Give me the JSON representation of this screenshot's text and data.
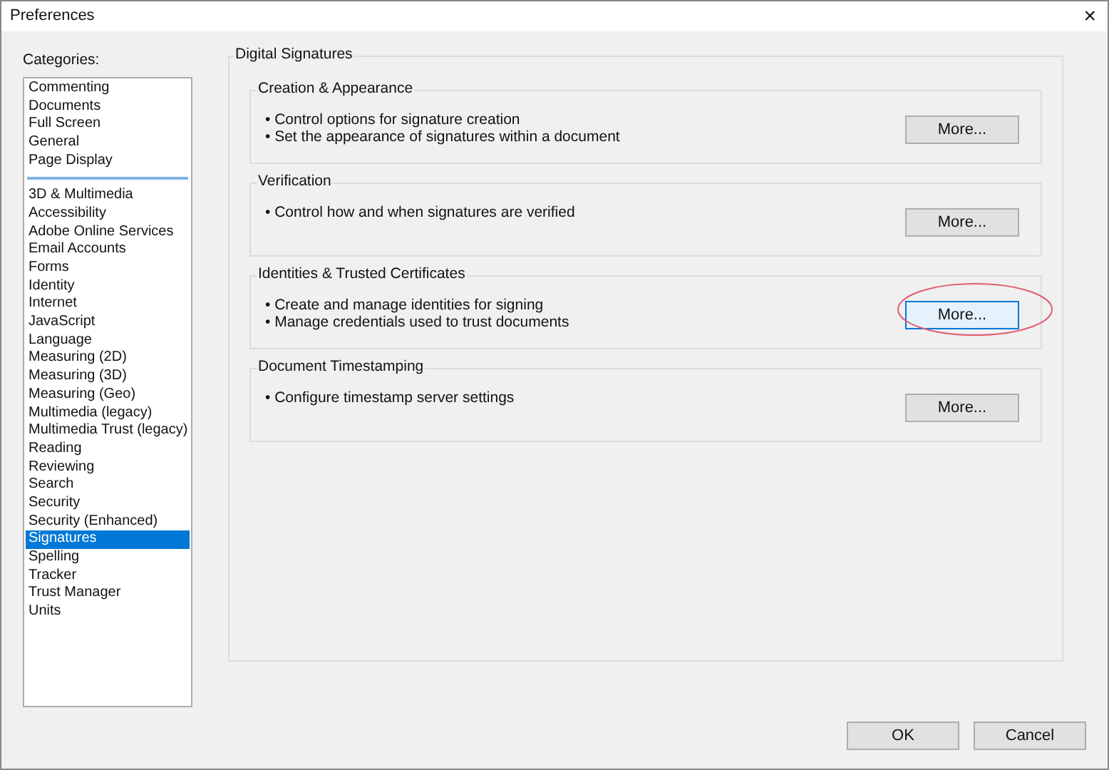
{
  "window": {
    "title": "Preferences",
    "close": "×"
  },
  "categories": {
    "label": "Categories:",
    "groups": [
      {
        "items": [
          {
            "label": "Commenting",
            "selected": false
          },
          {
            "label": "Documents",
            "selected": false
          },
          {
            "label": "Full Screen",
            "selected": false
          },
          {
            "label": "General",
            "selected": false
          },
          {
            "label": "Page Display",
            "selected": false
          }
        ]
      },
      {
        "items": [
          {
            "label": "3D & Multimedia",
            "selected": false
          },
          {
            "label": "Accessibility",
            "selected": false
          },
          {
            "label": "Adobe Online Services",
            "selected": false
          },
          {
            "label": "Email Accounts",
            "selected": false
          },
          {
            "label": "Forms",
            "selected": false
          },
          {
            "label": "Identity",
            "selected": false
          },
          {
            "label": "Internet",
            "selected": false
          },
          {
            "label": "JavaScript",
            "selected": false
          },
          {
            "label": "Language",
            "selected": false
          },
          {
            "label": "Measuring (2D)",
            "selected": false
          },
          {
            "label": "Measuring (3D)",
            "selected": false
          },
          {
            "label": "Measuring (Geo)",
            "selected": false
          },
          {
            "label": "Multimedia (legacy)",
            "selected": false
          },
          {
            "label": "Multimedia Trust (legacy)",
            "selected": false
          },
          {
            "label": "Reading",
            "selected": false
          },
          {
            "label": "Reviewing",
            "selected": false
          },
          {
            "label": "Search",
            "selected": false
          },
          {
            "label": "Security",
            "selected": false
          },
          {
            "label": "Security (Enhanced)",
            "selected": false
          },
          {
            "label": "Signatures",
            "selected": true
          },
          {
            "label": "Spelling",
            "selected": false
          },
          {
            "label": "Tracker",
            "selected": false
          },
          {
            "label": "Trust Manager",
            "selected": false
          },
          {
            "label": "Units",
            "selected": false
          }
        ]
      }
    ]
  },
  "panel": {
    "title": "Digital Signatures",
    "sections": [
      {
        "title": "Creation & Appearance",
        "bullets": [
          "• Control options for signature creation",
          "• Set the appearance of signatures within a document"
        ],
        "button": "More...",
        "focused": false,
        "circled": false
      },
      {
        "title": "Verification",
        "bullets": [
          "• Control how and when signatures are verified"
        ],
        "button": "More...",
        "focused": false,
        "circled": false
      },
      {
        "title": "Identities & Trusted Certificates",
        "bullets": [
          "• Create and manage identities for signing",
          "• Manage credentials used to trust documents"
        ],
        "button": "More...",
        "focused": true,
        "circled": true
      },
      {
        "title": "Document Timestamping",
        "bullets": [
          "• Configure timestamp server settings"
        ],
        "button": "More...",
        "focused": false,
        "circled": false
      }
    ]
  },
  "buttons": [
    "OK",
    "Cancel"
  ]
}
